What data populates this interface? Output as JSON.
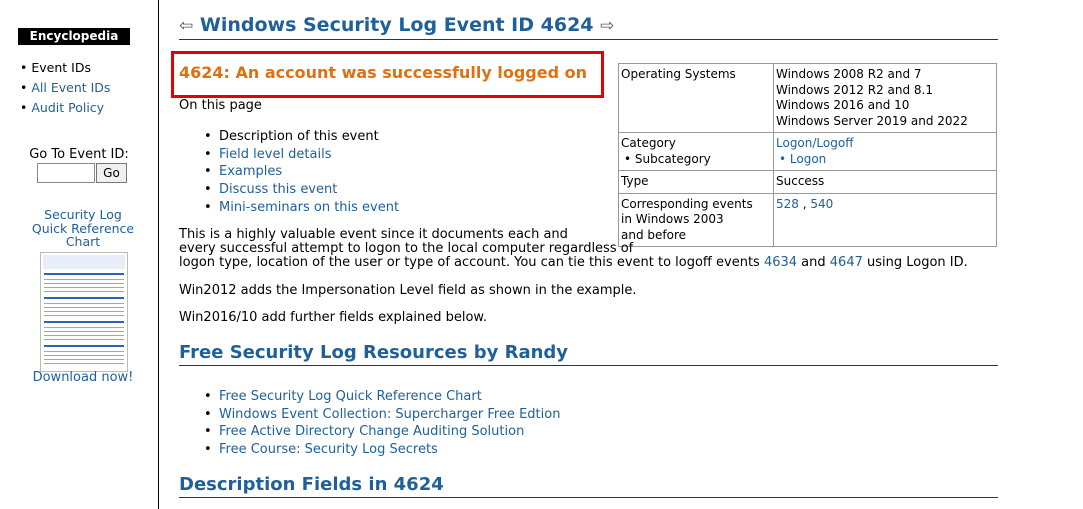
{
  "sidebar": {
    "encyclopedia": "Encyclopedia",
    "nav": [
      {
        "label": "Event IDs",
        "link": false
      },
      {
        "label": "All Event IDs",
        "link": true
      },
      {
        "label": "Audit Policy",
        "link": true
      }
    ],
    "goto_label": "Go To Event ID:",
    "goto_input_value": "",
    "goto_button": "Go",
    "qrc_line1": "Security Log",
    "qrc_line2": "Quick Reference",
    "qrc_line3": "Chart",
    "download": "Download now!"
  },
  "main": {
    "title": "Windows Security Log Event ID 4624",
    "subtitle": "4624: An account was successfully logged on",
    "on_this_page": "On this page",
    "toc": [
      "Description of this event",
      "Field level details",
      "Examples",
      "Discuss this event",
      "Mini-seminars on this event"
    ],
    "para1_line1": "This is a highly valuable event since it documents each and",
    "para1_line2": "every successful attempt to logon to the local computer regardless of",
    "para1_line3_a": "logon type, location of the user or type of account.  You can tie this event to logoff events ",
    "para1_link1": "4634",
    "para1_mid": " and ",
    "para1_link2": "4647",
    "para1_end": " using Logon ID.",
    "para2": "Win2012 adds the Impersonation Level field as shown in the example.",
    "para3": "Win2016/10 add further fields explained below.",
    "resources_heading": "Free Security Log Resources by Randy",
    "resources": [
      "Free Security Log Quick Reference Chart",
      "Windows Event Collection: Supercharger Free Edtion",
      "Free Active Directory Change Auditing Solution",
      "Free Course: Security Log Secrets"
    ],
    "desc_heading": "Description Fields in 4624"
  },
  "info_table": {
    "os_label": "Operating Systems",
    "os_values": [
      "Windows 2008 R2 and 7",
      "Windows 2012 R2 and 8.1",
      "Windows 2016 and 10",
      "Windows Server 2019 and 2022"
    ],
    "category_label": "Category",
    "subcategory_label": "• Subcategory",
    "category_value": "Logon/Logoff",
    "subcategory_value": "• Logon",
    "type_label": "Type",
    "type_value": "Success",
    "corr_line1": "Corresponding events",
    "corr_line2": "in Windows 2003",
    "corr_line3": "and before",
    "corr_link1": "528",
    "corr_sep": " , ",
    "corr_link2": "540"
  }
}
